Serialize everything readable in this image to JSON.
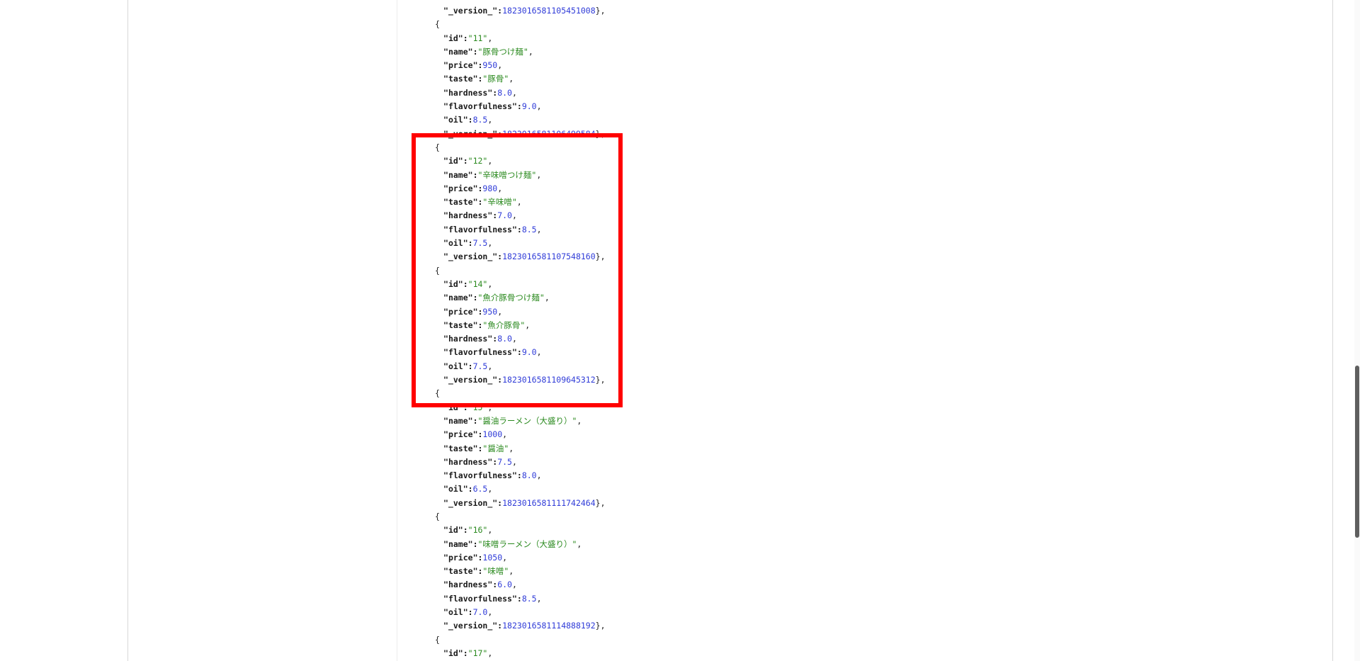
{
  "colors": {
    "key": "#1a1a1a",
    "string": "#2b8a1f",
    "number": "#2f3bd8",
    "highlight": "#ff0000"
  },
  "json_lines": [
    {
      "indent": 2,
      "key": "_version_",
      "value": "1823016581105451008",
      "vtype": "number",
      "suffix": "},"
    },
    {
      "indent": 1,
      "text": "{"
    },
    {
      "indent": 2,
      "key": "id",
      "value": "\"11\"",
      "vtype": "string",
      "suffix": ","
    },
    {
      "indent": 2,
      "key": "name",
      "value": "\"豚骨つけ麺\"",
      "vtype": "string",
      "suffix": ","
    },
    {
      "indent": 2,
      "key": "price",
      "value": "950",
      "vtype": "number",
      "suffix": ","
    },
    {
      "indent": 2,
      "key": "taste",
      "value": "\"豚骨\"",
      "vtype": "string",
      "suffix": ","
    },
    {
      "indent": 2,
      "key": "hardness",
      "value": "8.0",
      "vtype": "number",
      "suffix": ","
    },
    {
      "indent": 2,
      "key": "flavorfulness",
      "value": "9.0",
      "vtype": "number",
      "suffix": ","
    },
    {
      "indent": 2,
      "key": "oil",
      "value": "8.5",
      "vtype": "number",
      "suffix": ","
    },
    {
      "indent": 2,
      "key": "_version_",
      "value": "1823016581106499584",
      "vtype": "number",
      "suffix": "},"
    },
    {
      "indent": 1,
      "text": "{"
    },
    {
      "indent": 2,
      "key": "id",
      "value": "\"12\"",
      "vtype": "string",
      "suffix": ","
    },
    {
      "indent": 2,
      "key": "name",
      "value": "\"辛味噌つけ麺\"",
      "vtype": "string",
      "suffix": ","
    },
    {
      "indent": 2,
      "key": "price",
      "value": "980",
      "vtype": "number",
      "suffix": ","
    },
    {
      "indent": 2,
      "key": "taste",
      "value": "\"辛味噌\"",
      "vtype": "string",
      "suffix": ","
    },
    {
      "indent": 2,
      "key": "hardness",
      "value": "7.0",
      "vtype": "number",
      "suffix": ","
    },
    {
      "indent": 2,
      "key": "flavorfulness",
      "value": "8.5",
      "vtype": "number",
      "suffix": ","
    },
    {
      "indent": 2,
      "key": "oil",
      "value": "7.5",
      "vtype": "number",
      "suffix": ","
    },
    {
      "indent": 2,
      "key": "_version_",
      "value": "1823016581107548160",
      "vtype": "number",
      "suffix": "},"
    },
    {
      "indent": 1,
      "text": "{"
    },
    {
      "indent": 2,
      "key": "id",
      "value": "\"14\"",
      "vtype": "string",
      "suffix": ","
    },
    {
      "indent": 2,
      "key": "name",
      "value": "\"魚介豚骨つけ麺\"",
      "vtype": "string",
      "suffix": ","
    },
    {
      "indent": 2,
      "key": "price",
      "value": "950",
      "vtype": "number",
      "suffix": ","
    },
    {
      "indent": 2,
      "key": "taste",
      "value": "\"魚介豚骨\"",
      "vtype": "string",
      "suffix": ","
    },
    {
      "indent": 2,
      "key": "hardness",
      "value": "8.0",
      "vtype": "number",
      "suffix": ","
    },
    {
      "indent": 2,
      "key": "flavorfulness",
      "value": "9.0",
      "vtype": "number",
      "suffix": ","
    },
    {
      "indent": 2,
      "key": "oil",
      "value": "7.5",
      "vtype": "number",
      "suffix": ","
    },
    {
      "indent": 2,
      "key": "_version_",
      "value": "1823016581109645312",
      "vtype": "number",
      "suffix": "},"
    },
    {
      "indent": 1,
      "text": "{"
    },
    {
      "indent": 2,
      "key": "id",
      "value": "\"15\"",
      "vtype": "string",
      "suffix": ","
    },
    {
      "indent": 2,
      "key": "name",
      "value": "\"醤油ラーメン（大盛り）\"",
      "vtype": "string",
      "suffix": ","
    },
    {
      "indent": 2,
      "key": "price",
      "value": "1000",
      "vtype": "number",
      "suffix": ","
    },
    {
      "indent": 2,
      "key": "taste",
      "value": "\"醤油\"",
      "vtype": "string",
      "suffix": ","
    },
    {
      "indent": 2,
      "key": "hardness",
      "value": "7.5",
      "vtype": "number",
      "suffix": ","
    },
    {
      "indent": 2,
      "key": "flavorfulness",
      "value": "8.0",
      "vtype": "number",
      "suffix": ","
    },
    {
      "indent": 2,
      "key": "oil",
      "value": "6.5",
      "vtype": "number",
      "suffix": ","
    },
    {
      "indent": 2,
      "key": "_version_",
      "value": "1823016581111742464",
      "vtype": "number",
      "suffix": "},"
    },
    {
      "indent": 1,
      "text": "{"
    },
    {
      "indent": 2,
      "key": "id",
      "value": "\"16\"",
      "vtype": "string",
      "suffix": ","
    },
    {
      "indent": 2,
      "key": "name",
      "value": "\"味噌ラーメン（大盛り）\"",
      "vtype": "string",
      "suffix": ","
    },
    {
      "indent": 2,
      "key": "price",
      "value": "1050",
      "vtype": "number",
      "suffix": ","
    },
    {
      "indent": 2,
      "key": "taste",
      "value": "\"味噌\"",
      "vtype": "string",
      "suffix": ","
    },
    {
      "indent": 2,
      "key": "hardness",
      "value": "6.0",
      "vtype": "number",
      "suffix": ","
    },
    {
      "indent": 2,
      "key": "flavorfulness",
      "value": "8.5",
      "vtype": "number",
      "suffix": ","
    },
    {
      "indent": 2,
      "key": "oil",
      "value": "7.0",
      "vtype": "number",
      "suffix": ","
    },
    {
      "indent": 2,
      "key": "_version_",
      "value": "1823016581114888192",
      "vtype": "number",
      "suffix": "},"
    },
    {
      "indent": 1,
      "text": "{"
    },
    {
      "indent": 2,
      "key": "id",
      "value": "\"17\"",
      "vtype": "string",
      "suffix": ","
    }
  ]
}
